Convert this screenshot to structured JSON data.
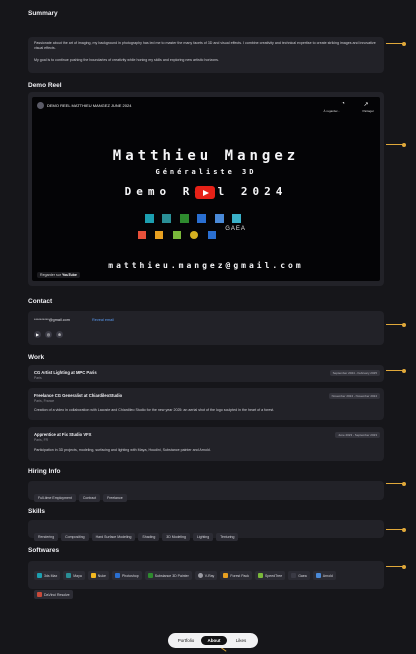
{
  "summary": {
    "heading": "Summary",
    "paragraph1": "Passionate about the art of imaging, my background in photography has led me to master the many facets of 3D and visual effects. I combine creativity and technical expertise to create striking images and innovative visual effects.",
    "paragraph2": "My goal is to continue pushing the boundaries of creativity while honing my skills and exploring new artistic horizons."
  },
  "demo_reel": {
    "heading": "Demo Reel",
    "video_title": "DEMO REEL MATTHIEU MANGEZ JUNE 2024",
    "watch_later": "À regarder...",
    "share": "Partager",
    "name": "Matthieu Mangez",
    "role": "Généraliste 3D",
    "reel_label": "Demo Reel 2024",
    "email": "matthieu.mangez@gmail.com",
    "watch_on": "Regarder sur",
    "youtube": "YouTube",
    "logo_text": "GAEA"
  },
  "contact": {
    "heading": "Contact",
    "email_masked": "**********@gmail.com",
    "reveal_label": "Reveal email"
  },
  "work": {
    "heading": "Work",
    "entries": [
      {
        "title": "CG Artist Lighting at MPC Paris",
        "location": "Paris",
        "dates": "September 2024 - February 2025",
        "desc": ""
      },
      {
        "title": "Freelance CG Generalist at ChiardileoStudio",
        "location": "Paris, France",
        "dates": "November 2024 - November 2024",
        "desc": "Creation of a video in collaboration with Lacoste and Chiardileo Studio for the new year 2025: an aerial shot of the logo sculpted in the heart of a forest."
      },
      {
        "title": "Apprentice at Fix Studio VFX",
        "location": "Paris, FR",
        "dates": "June 2023 - September 2023",
        "desc": "Participation in 3D projects, modeling, surfacing and lighting with Maya, Houdini, Substance painter and Arnold."
      }
    ]
  },
  "hiring": {
    "heading": "Hiring Info",
    "chips": [
      "Full-time Employment",
      "Contract",
      "Freelance"
    ]
  },
  "skills": {
    "heading": "Skills",
    "chips": [
      "Rendering",
      "Compositing",
      "Hard Surface Modeling",
      "Shading",
      "3D Modeling",
      "Lighting",
      "Texturing"
    ]
  },
  "softwares": {
    "heading": "Softwares",
    "items": [
      {
        "label": "3ds Max",
        "color": "#1c9fb0"
      },
      {
        "label": "Maya",
        "color": "#2a8f96"
      },
      {
        "label": "Nuke",
        "color": "#f2b820"
      },
      {
        "label": "Photoshop",
        "color": "#2a6fd1"
      },
      {
        "label": "Substance 3D Painter",
        "color": "#2e8b2e"
      },
      {
        "label": "V-Ray",
        "color": "#9a9aa2"
      },
      {
        "label": "Forest Pack",
        "color": "#e8a020"
      },
      {
        "label": "SpeedTree",
        "color": "#7ab83a"
      },
      {
        "label": "Gaea",
        "color": "#3a3a44"
      },
      {
        "label": "Arnold",
        "color": "#4a8ad8"
      },
      {
        "label": "DaVinci Resolve",
        "color": "#c84a3a"
      }
    ]
  },
  "bottom_tabs": {
    "portfolio": "Portfolio",
    "about": "About",
    "likes": "Likes"
  },
  "accent_color": "#e0a83a"
}
